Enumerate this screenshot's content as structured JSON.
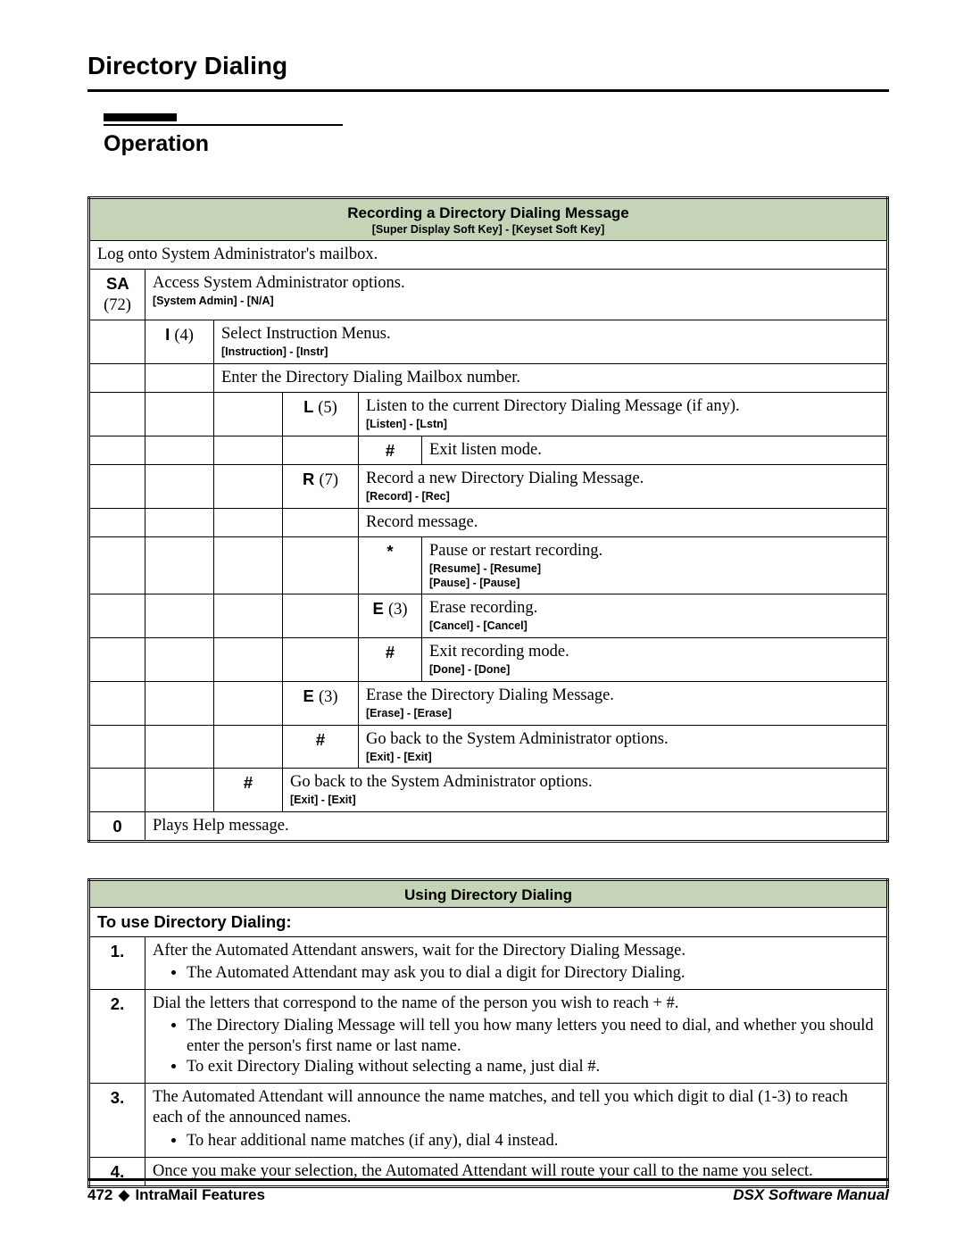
{
  "page_title": "Directory Dialing",
  "section_title": "Operation",
  "table1": {
    "header_main": "Recording a Directory Dialing Message",
    "header_sub": "[Super Display Soft Key] - [Keyset Soft Key]",
    "row_log": "Log onto System Administrator's mailbox.",
    "sa_key": "SA",
    "sa_paren": "(72)",
    "sa_desc": "Access System Administrator options.",
    "sa_soft": "[System Admin] - [N/A]",
    "i_key": "I",
    "i_paren": "(4)",
    "i_desc": "Select Instruction Menus.",
    "i_soft": "[Instruction] - [Instr]",
    "enter_dd": "Enter the Directory Dialing Mailbox number.",
    "l_key": "L",
    "l_paren": "(5)",
    "l_desc": "Listen to the current Directory Dialing Message (if any).",
    "l_soft": "[Listen] - [Lstn]",
    "hash1": "#",
    "hash1_desc": "Exit listen mode.",
    "r_key": "R",
    "r_paren": "(7)",
    "r_desc": "Record a new Directory Dialing Message.",
    "r_soft": "[Record] - [Rec]",
    "record_msg": "Record message.",
    "star": "*",
    "star_desc": "Pause or restart recording.",
    "star_soft1": "[Resume] - [Resume]",
    "star_soft2": "[Pause] - [Pause]",
    "e3a_key": "E",
    "e3a_paren": "(3)",
    "e3a_desc": "Erase recording.",
    "e3a_soft": "[Cancel] - [Cancel]",
    "hash2": "#",
    "hash2_desc": "Exit recording mode.",
    "hash2_soft": "[Done] - [Done]",
    "e3b_key": "E",
    "e3b_paren": "(3)",
    "e3b_desc": "Erase the Directory Dialing Message.",
    "e3b_soft": "[Erase] - [Erase]",
    "hash3": "#",
    "hash3_desc": "Go back to the System Administrator options.",
    "hash3_soft": "[Exit] - [Exit]",
    "hash4": "#",
    "hash4_desc": "Go back to the System Administrator options.",
    "hash4_soft": "[Exit] - [Exit]",
    "zero": "0",
    "zero_desc": "Plays Help message."
  },
  "table2": {
    "header": "Using Directory Dialing",
    "subheader": "To use Directory Dialing:",
    "s1_num": "1.",
    "s1_text": "After the Automated Attendant answers, wait for the Directory Dialing Message.",
    "s1_b1": "The Automated Attendant may ask you to dial a digit for Directory Dialing.",
    "s2_num": "2.",
    "s2_text": "Dial the letters that correspond to the name of the person you wish to reach + #.",
    "s2_b1": "The Directory Dialing Message will tell you how many letters you need to dial, and whether you should enter the person's first name or last name.",
    "s2_b2": "To exit Directory Dialing without selecting a name, just dial #.",
    "s3_num": "3.",
    "s3_text": "The Automated Attendant will announce the name matches, and tell you which digit to dial (1-3) to reach each of the announced names.",
    "s3_b1": "To hear additional name matches (if any), dial 4 instead.",
    "s4_num": "4.",
    "s4_text": "Once you make your selection, the Automated Attendant will route your call to the name you select."
  },
  "footer": {
    "page_num": "472",
    "section": "IntraMail Features",
    "manual": "DSX Software Manual"
  }
}
